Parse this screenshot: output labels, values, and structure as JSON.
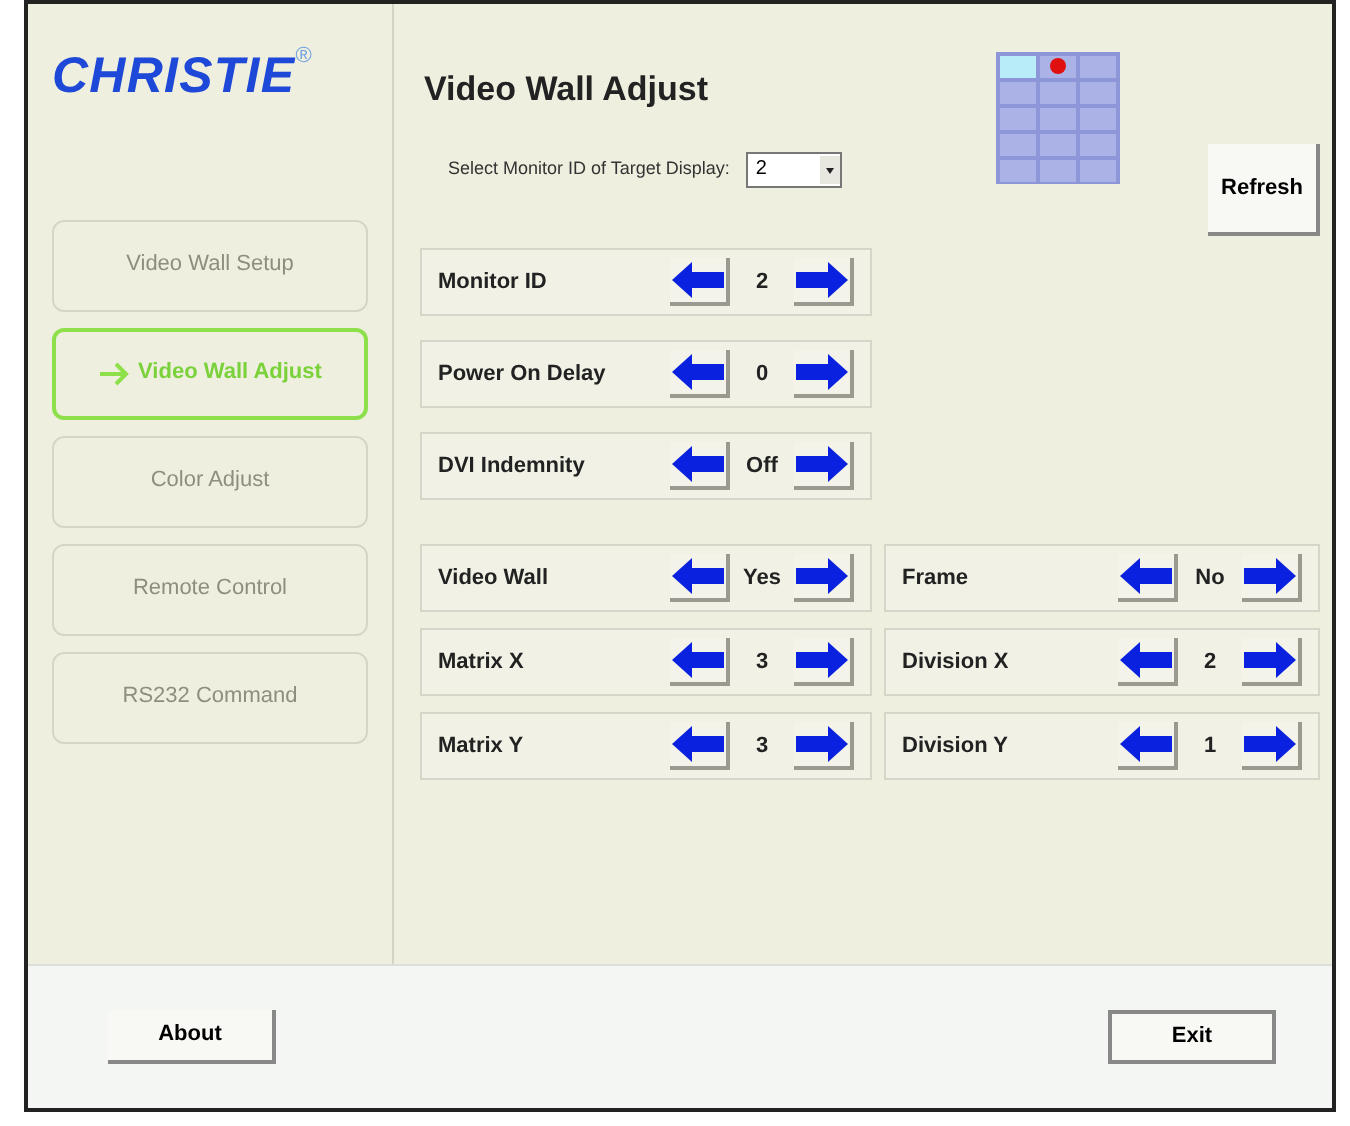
{
  "logo": {
    "text": "CHRISTIE",
    "mark": "®"
  },
  "sidebar": {
    "items": [
      {
        "label": "Video Wall Setup",
        "selected": false,
        "disabled": true
      },
      {
        "label": "Video Wall Adjust",
        "selected": true,
        "disabled": false
      },
      {
        "label": "Color Adjust",
        "selected": false,
        "disabled": true
      },
      {
        "label": "Remote Control",
        "selected": false,
        "disabled": true
      },
      {
        "label": "RS232 Command",
        "selected": false,
        "disabled": true
      }
    ]
  },
  "title": "Video Wall Adjust",
  "monitor_select": {
    "label": "Select Monitor ID of Target Display:",
    "value": "2"
  },
  "refresh_button": "Refresh",
  "settings": [
    {
      "label": "Monitor ID",
      "value": "2"
    },
    {
      "label": "Power On Delay",
      "value": "0"
    },
    {
      "label": "DVI Indemnity",
      "value": "Off"
    }
  ],
  "wall_settings": [
    {
      "label": "Video Wall",
      "value": "Yes"
    },
    {
      "label": "Frame",
      "value": "No"
    },
    {
      "label": "Matrix X",
      "value": "3"
    },
    {
      "label": "Division X",
      "value": "2"
    },
    {
      "label": "Matrix Y",
      "value": "3"
    },
    {
      "label": "Division Y",
      "value": "1"
    }
  ],
  "footer": {
    "about_button": "About",
    "exit_button": "Exit"
  }
}
